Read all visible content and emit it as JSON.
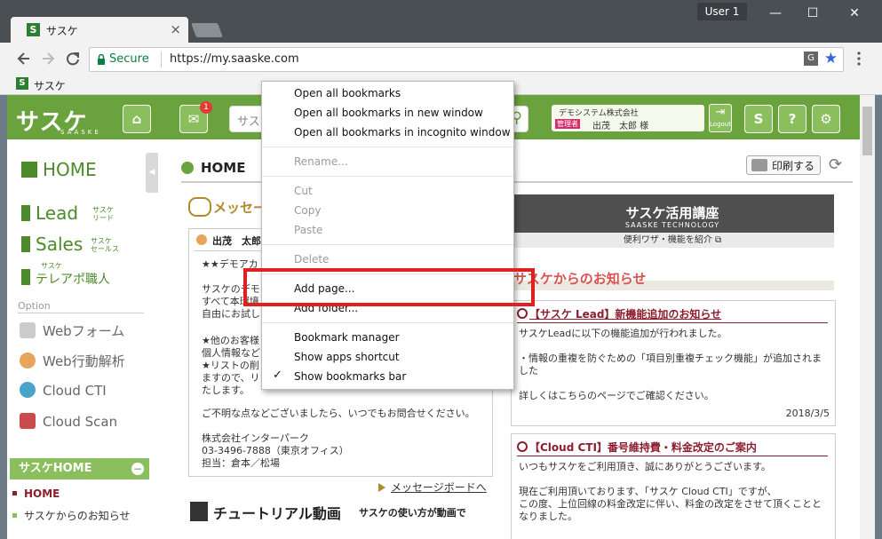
{
  "browser": {
    "tab_title": "サスケ",
    "tab_close": "×",
    "tab_favicon": "S",
    "user_label": "User 1",
    "window_buttons": [
      "—",
      "☐",
      "✕"
    ],
    "nav_icons": [
      "back-icon",
      "forward-icon",
      "reload-icon"
    ],
    "secure_label": "Secure",
    "url": "https://my.saaske.com",
    "bookmark_label": "サスケ",
    "bookmark_favicon": "S"
  },
  "header": {
    "logo": "サスケ",
    "logo_sub": "SAASKE",
    "notification_count": "1",
    "search_placeholder": "サス",
    "company": "デモシステム株式会社",
    "role": "管理者",
    "user_name": "出茂　太郎 様",
    "logout_label": "Logout",
    "icon_glyphs": {
      "home": "⌂",
      "message": "✉",
      "search": "⚲",
      "saaske": "S",
      "help": "?",
      "settings": "⚙"
    }
  },
  "leftnav": {
    "fold_glyph": "◀",
    "home": "HOME",
    "lead": "Lead",
    "lead_sub": [
      "サスケ",
      "リード"
    ],
    "sales": "Sales",
    "sales_sub": [
      "サスケ",
      "セールス"
    ],
    "tele_sub": "サスケ",
    "tele": "テレアポ職人",
    "option_label": "Option",
    "options": [
      "Webフォーム",
      "Web行動解析",
      "Cloud CTI",
      "Cloud Scan"
    ],
    "section_title": "サスケHOME",
    "section_toggle": "−",
    "sub_items": [
      "HOME",
      "サスケからのお知らせ"
    ]
  },
  "main": {
    "title": "HOME",
    "print_button": "印刷する",
    "refresh_glyph": "⟳",
    "message_board_title": "メッセー",
    "message_from": "出茂　太郎",
    "message_lines": [
      "★★デモアカ",
      "",
      "サスケのデモ",
      "すべて本環境",
      "自由にお試し",
      "",
      "★他のお客様",
      "個人情報など",
      "★リストの削",
      "ますので、リ",
      "たします。",
      "",
      "ご不明な点などございましたら、いつでもお問合せください。",
      "",
      "株式会社インターパーク",
      "03-3496-7888（東京オフィス）",
      "担当：倉本／松場"
    ],
    "message_board_link": "メッセージボードへ",
    "tutorial_title": "チュートリアル動画",
    "tutorial_sub": "サスケの使い方が動画で",
    "banner_title": "サスケ活用講座",
    "banner_sub": "SAASKE TECHNOLOGY",
    "banner_link": "便利ワザ・機能を紹介",
    "notice_title": "サスケからのお知らせ",
    "news": [
      {
        "title": "【サスケ Lead】新機能追加のお知らせ",
        "lines": [
          "サスケLeadに以下の機能追加が行われました。",
          "",
          "・情報の重複を防ぐための「項目別重複チェック機能」が追加されま",
          "した",
          "",
          "詳しくはこちらのページでご確認ください。"
        ],
        "date": "2018/3/5"
      },
      {
        "title": "【Cloud CTI】番号維持費・料金改定のご案内",
        "lines": [
          "いつもサスケをご利用頂き、誠にありがとうございます。",
          "",
          "現在ご利用頂いております、「サスケ Cloud CTI」ですが、",
          "この度、上位回線の料金改定に伴い、料金の改定をさせて頂くことと",
          "なりました。"
        ]
      }
    ]
  },
  "context_menu": {
    "items": [
      {
        "label": "Open all bookmarks",
        "enabled": true
      },
      {
        "label": "Open all bookmarks in new window",
        "enabled": true
      },
      {
        "label": "Open all bookmarks in incognito window",
        "enabled": true
      },
      {
        "label": "Rename...",
        "enabled": false
      },
      {
        "label": "Cut",
        "enabled": false
      },
      {
        "label": "Copy",
        "enabled": false
      },
      {
        "label": "Paste",
        "enabled": false
      },
      {
        "label": "Delete",
        "enabled": false
      },
      {
        "label": "Add page...",
        "enabled": true
      },
      {
        "label": "Add folder...",
        "enabled": true
      },
      {
        "label": "Bookmark manager",
        "enabled": true
      },
      {
        "label": "Show apps shortcut",
        "enabled": true
      },
      {
        "label": "Show bookmarks bar",
        "enabled": true,
        "checked": true
      }
    ],
    "check_glyph": "✓"
  },
  "colors": {
    "brand_green": "#6aa33d",
    "highlight_red": "#e01f1f",
    "news_title": "#8b1d2c"
  }
}
